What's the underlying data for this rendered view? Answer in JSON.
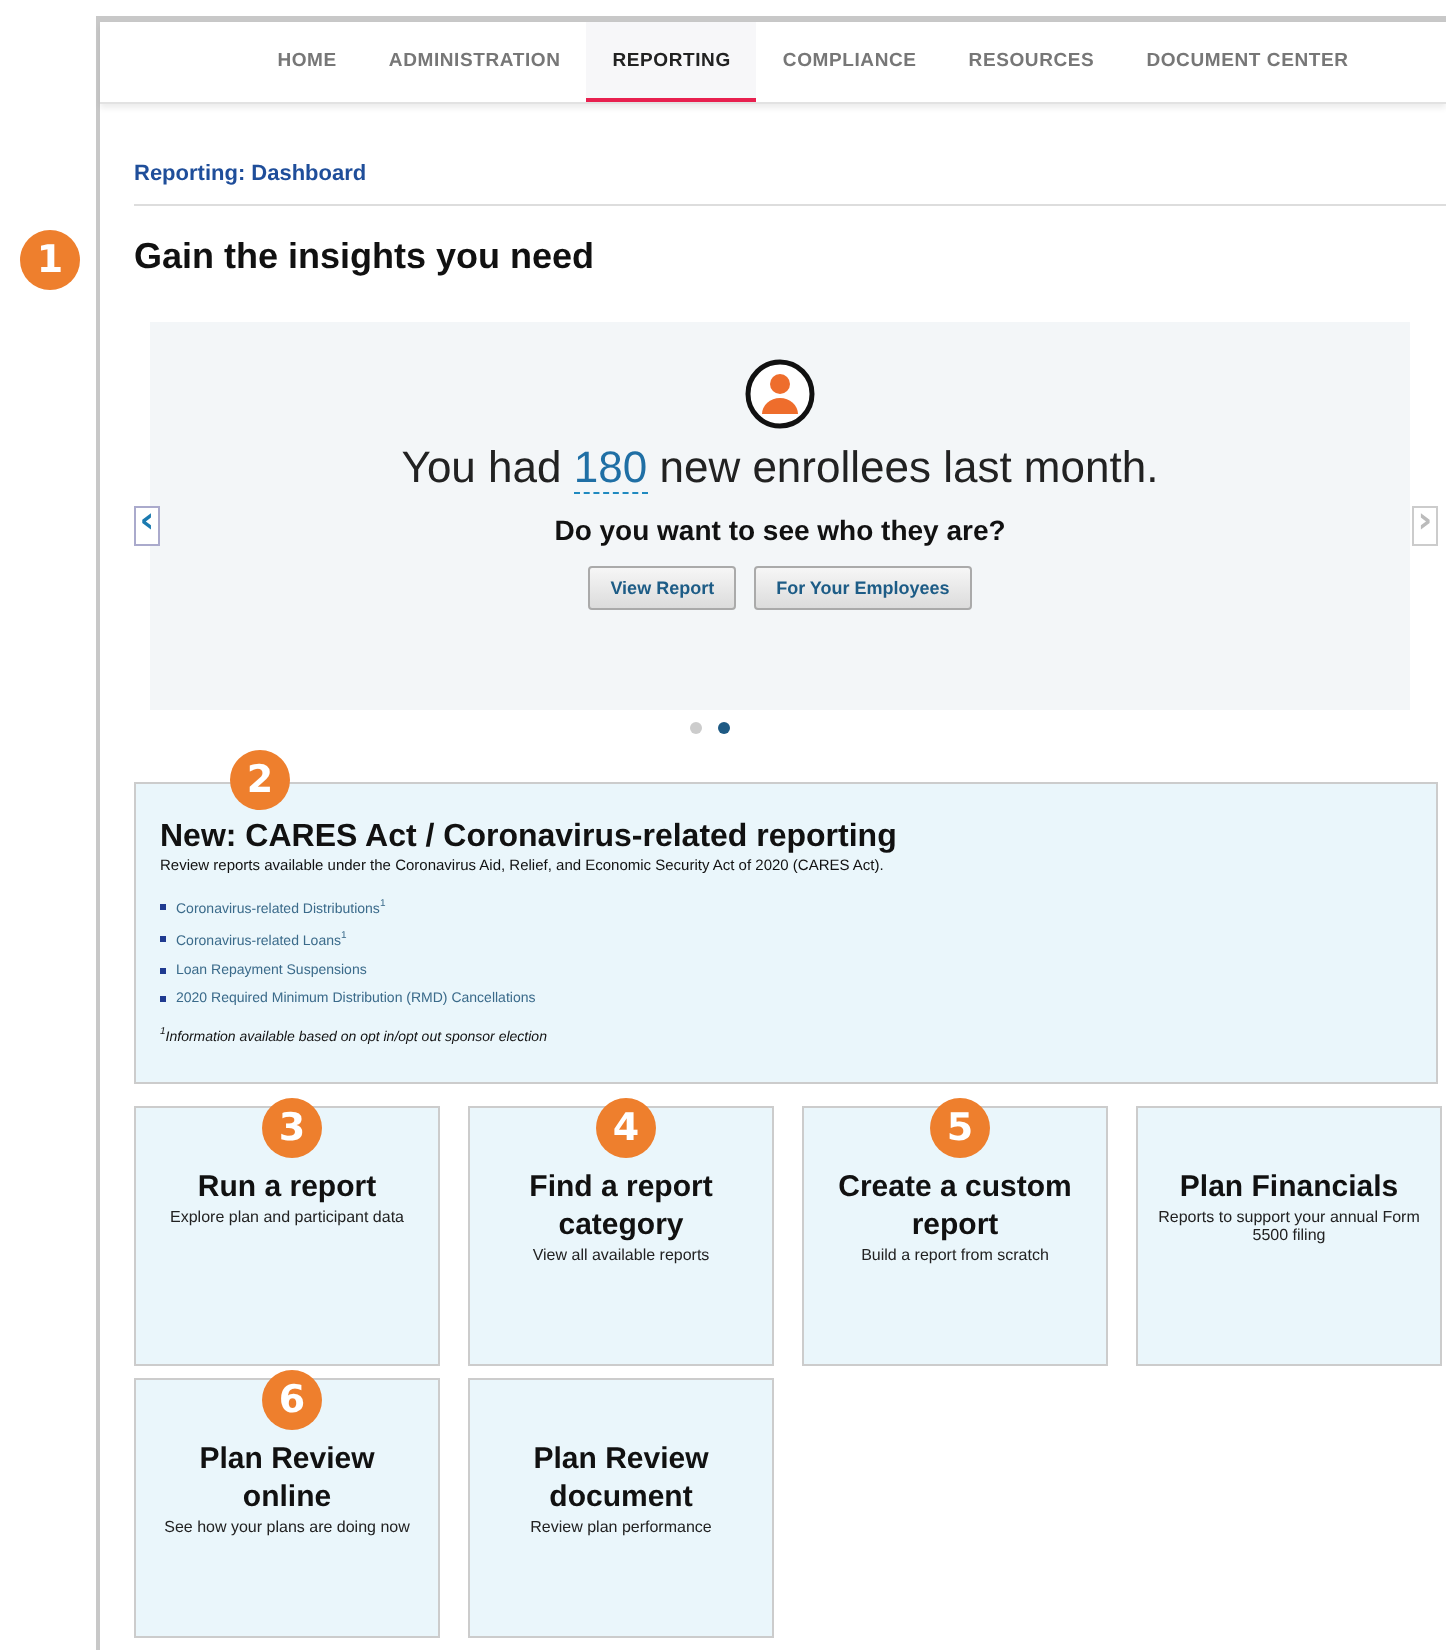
{
  "nav": {
    "tabs": [
      {
        "label": "HOME",
        "selected": false
      },
      {
        "label": "ADMINISTRATION",
        "selected": false
      },
      {
        "label": "REPORTING",
        "selected": true
      },
      {
        "label": "COMPLIANCE",
        "selected": false
      },
      {
        "label": "RESOURCES",
        "selected": false
      },
      {
        "label": "DOCUMENT CENTER",
        "selected": false
      }
    ]
  },
  "breadcrumb": "Reporting: Dashboard",
  "heading": {
    "text": "Gain the insights you need",
    "callout": "1"
  },
  "carousel": {
    "headline_before": "You had",
    "headline_number": "180",
    "headline_after": "new enrollees last month.",
    "question": "Do you want to see who they are?",
    "buttons": [
      "View Report",
      "For Your Employees"
    ],
    "prev": "‹",
    "next": "›",
    "dots": [
      {
        "selected": false
      },
      {
        "selected": true
      }
    ]
  },
  "notice": {
    "callout": "2",
    "title": "New: CARES Act / Coronavirus-related reporting",
    "subtitle": "Review reports available under the Coronavirus Aid, Relief, and Economic Security Act of 2020 (CARES Act).",
    "links": [
      "Coronavirus-related Distributions$^{1}$",
      "Coronavirus-related Loans$^{1}$",
      "Loan Repayment Suspensions",
      "2020 Required Minimum Distribution (RMD) Cancellations"
    ],
    "footnote": "$^{1}$Information available based on opt in/opt out sponsor election"
  },
  "tiles": [
    {
      "callout": "3",
      "title": "Run a report",
      "description": "Explore plan and participant data"
    },
    {
      "callout": "4",
      "title": "Find a report category",
      "description": "View all available reports"
    },
    {
      "callout": "5",
      "title": "Create a custom report",
      "description": "Build a report from scratch"
    },
    {
      "title": "Plan Financials",
      "description": "Reports to support your annual Form 5500 filing"
    },
    {
      "callout": "6",
      "title": "Plan Review online",
      "description": "See how your plans are doing now"
    },
    {
      "title": "Plan Review document",
      "description": "Review plan performance"
    }
  ]
}
